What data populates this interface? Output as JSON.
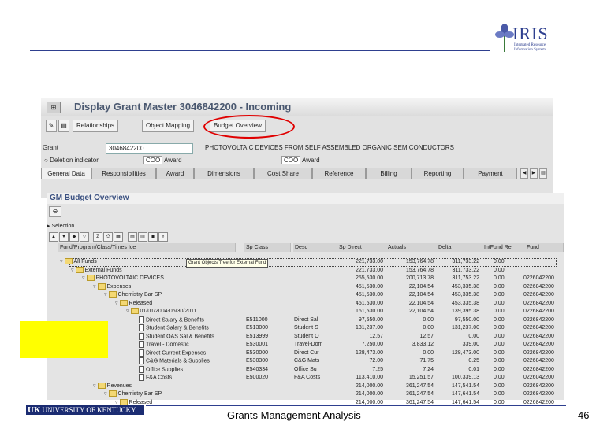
{
  "slide": {
    "footer_title": "Grants Management Analysis",
    "page_number": "46",
    "logo_iris": "IRIS",
    "logo_iris_sub1": "Integrated Resource",
    "logo_iris_sub2": "Information System",
    "logo_uk": "UNIVERSITY OF KENTUCKY",
    "logo_uk_mark": "UK",
    "accent_color": "#2e3f8f",
    "highlight_color": "#ffff00"
  },
  "sap_window": {
    "title": "Display Grant Master 3046842200 - Incoming",
    "toolbar": {
      "relationships": "Relationships",
      "object_mapping": "Object Mapping",
      "budget_overview": "Budget Overview"
    },
    "grant_label": "Grant",
    "grant_value": "3046842200",
    "grant_description": "PHOTOVOLTAIC DEVICES FROM SELF ASSEMBLED ORGANIC SEMICONDUCTORS",
    "deletion_indicator_label": "Deletion indicator",
    "status1": "Award",
    "status2": "Award",
    "tabs": [
      "General Data",
      "Responsibilities",
      "Award",
      "Dimensions",
      "Cost Share",
      "Reference",
      "Billing",
      "Reporting",
      "Payment"
    ]
  },
  "budget_overview": {
    "title": "GM Budget Overview",
    "selection_label": "Selection",
    "tooltip": "Grant Objects Tree for External Fund",
    "columns": [
      "Fund/Program/Class/Times Ice",
      "Sp Class",
      "Desc",
      "Sp Direct",
      "Actuals",
      "Delta",
      "IntFund Rel",
      "Fund"
    ],
    "rows": [
      {
        "indent": 0,
        "icon": "folder",
        "name": "All Funds",
        "spclass": "",
        "desc": "",
        "direct": "221,733.00",
        "actuals": "153,764.78",
        "delta": "311,733.22",
        "rel": "0.00",
        "fund": ""
      },
      {
        "indent": 1,
        "icon": "folder",
        "name": "External Funds",
        "spclass": "",
        "desc": "",
        "direct": "221,733.00",
        "actuals": "153,764.78",
        "delta": "311,733.22",
        "rel": "0.00",
        "fund": ""
      },
      {
        "indent": 2,
        "icon": "folder",
        "name": "PHOTOVOLTAIC DEVICES",
        "spclass": "",
        "desc": "",
        "direct": "255,530.00",
        "actuals": "200,713.78",
        "delta": "311,753.22",
        "rel": "0.00",
        "fund": "0226042200"
      },
      {
        "indent": 3,
        "icon": "folder",
        "name": "Expenses",
        "spclass": "",
        "desc": "",
        "direct": "451,530.00",
        "actuals": "22,104.54",
        "delta": "453,335.38",
        "rel": "0.00",
        "fund": "0226842200"
      },
      {
        "indent": 4,
        "icon": "folder",
        "name": "Chemistry Bar SP",
        "spclass": "",
        "desc": "",
        "direct": "451,530.00",
        "actuals": "22,104.54",
        "delta": "453,335.38",
        "rel": "0.00",
        "fund": "0226842200"
      },
      {
        "indent": 5,
        "icon": "folder",
        "name": "Released",
        "spclass": "",
        "desc": "",
        "direct": "451,530.00",
        "actuals": "22,104.54",
        "delta": "453,335.38",
        "rel": "0.00",
        "fund": "0226842200"
      },
      {
        "indent": 6,
        "icon": "folder",
        "name": "01/01/2004-06/30/2011",
        "spclass": "",
        "desc": "",
        "direct": "161,530.00",
        "actuals": "22,104.54",
        "delta": "139,395.38",
        "rel": "0.00",
        "fund": "0226842200"
      },
      {
        "indent": 7,
        "icon": "doc",
        "name": "Direct Salary & Benefits",
        "spclass": "E511000",
        "desc": "Direct Sal",
        "direct": "97,550.00",
        "actuals": "0.00",
        "delta": "97,550.00",
        "rel": "0.00",
        "fund": "0226842200"
      },
      {
        "indent": 7,
        "icon": "doc",
        "name": "Student Salary & Benefits",
        "spclass": "E513000",
        "desc": "Student S",
        "direct": "131,237.00",
        "actuals": "0.00",
        "delta": "131,237.00",
        "rel": "0.00",
        "fund": "0226842200"
      },
      {
        "indent": 7,
        "icon": "doc",
        "name": "Student OAS Sal & Benefits",
        "spclass": "E513999",
        "desc": "Student O",
        "direct": "12.57",
        "actuals": "12.57",
        "delta": "0.00",
        "rel": "0.00",
        "fund": "0226842200"
      },
      {
        "indent": 7,
        "icon": "doc",
        "name": "Travel - Domestic",
        "spclass": "E530001",
        "desc": "Travel-Dom",
        "direct": "7,250.00",
        "actuals": "3,833.12",
        "delta": "339.00",
        "rel": "0.00",
        "fund": "0226842200"
      },
      {
        "indent": 7,
        "icon": "doc",
        "name": "Direct Current Expenses",
        "spclass": "E530000",
        "desc": "Direct Cur",
        "direct": "128,473.00",
        "actuals": "0.00",
        "delta": "128,473.00",
        "rel": "0.00",
        "fund": "0226842200"
      },
      {
        "indent": 7,
        "icon": "doc",
        "name": "C&G Materials & Supplies",
        "spclass": "E530300",
        "desc": "C&G Mats",
        "direct": "72.00",
        "actuals": "71.75",
        "delta": "0.25",
        "rel": "0.00",
        "fund": "0226842200"
      },
      {
        "indent": 7,
        "icon": "doc",
        "name": "Office Supplies",
        "spclass": "E540334",
        "desc": "Office Su",
        "direct": "7.25",
        "actuals": "7.24",
        "delta": "0.01",
        "rel": "0.00",
        "fund": "0226842200"
      },
      {
        "indent": 7,
        "icon": "doc",
        "name": "F&A Costs",
        "spclass": "E500020",
        "desc": "F&A Costs",
        "direct": "113,410.00",
        "actuals": "15,251.57",
        "delta": "100,339.13",
        "rel": "0.00",
        "fund": "0226042200"
      },
      {
        "indent": 3,
        "icon": "folder",
        "name": "Revenues",
        "spclass": "",
        "desc": "",
        "direct": "214,000.00",
        "actuals": "361,247.54",
        "delta": "147,541.54",
        "rel": "0.00",
        "fund": "0226842200"
      },
      {
        "indent": 4,
        "icon": "folder",
        "name": "Chemistry Bar SP",
        "spclass": "",
        "desc": "",
        "direct": "214,000.00",
        "actuals": "361,247.54",
        "delta": "147,641.54",
        "rel": "0.00",
        "fund": "0226842200"
      },
      {
        "indent": 5,
        "icon": "folder",
        "name": "Released",
        "spclass": "",
        "desc": "",
        "direct": "214,000.00",
        "actuals": "361,247.54",
        "delta": "147,641.54",
        "rel": "0.00",
        "fund": "0226842200"
      }
    ]
  }
}
